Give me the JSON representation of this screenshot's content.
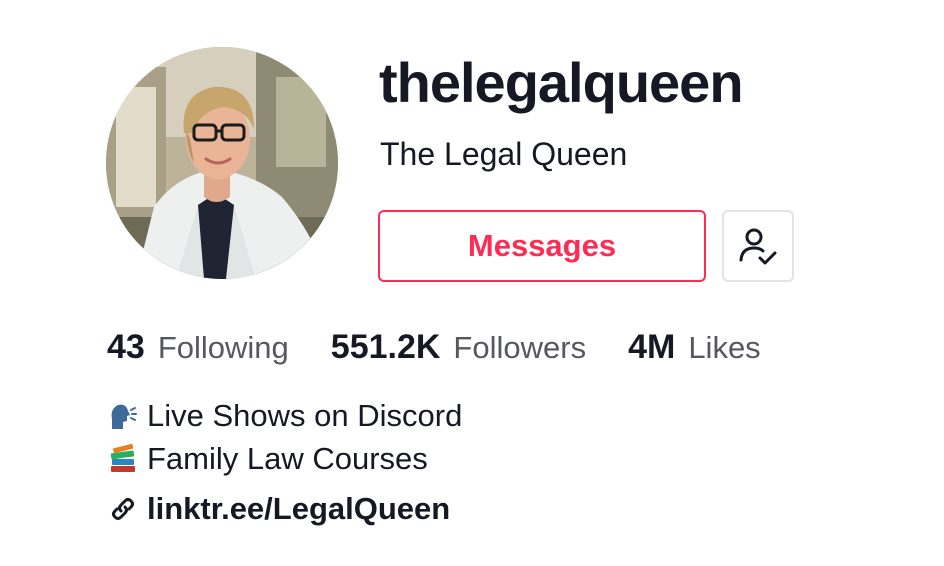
{
  "profile": {
    "username": "thelegalqueen",
    "display_name": "The Legal Queen",
    "avatar_icon": "profile-photo"
  },
  "actions": {
    "messages_label": "Messages",
    "following_icon": "user-check-icon",
    "accent_color": "#fe2c55"
  },
  "stats": [
    {
      "value": "43",
      "label": "Following"
    },
    {
      "value": "551.2K",
      "label": "Followers"
    },
    {
      "value": "4M",
      "label": "Likes"
    }
  ],
  "bio": {
    "lines": [
      {
        "icon": "speaking-head-emoji",
        "text": "Live Shows on Discord"
      },
      {
        "icon": "books-emoji",
        "text": "Family Law Courses"
      }
    ]
  },
  "link": {
    "icon": "link-icon",
    "text": "linktr.ee/LegalQueen"
  }
}
